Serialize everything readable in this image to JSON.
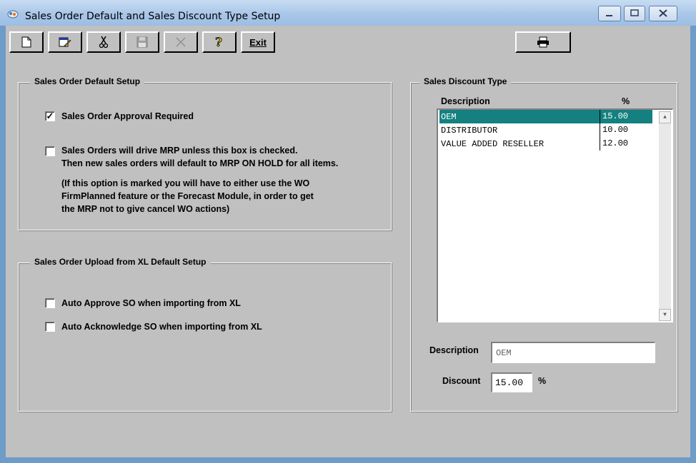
{
  "window": {
    "title": "Sales Order Default and Sales Discount Type Setup"
  },
  "toolbar": {
    "buttons": [
      {
        "name": "new",
        "icon": "new-document-icon"
      },
      {
        "name": "edit",
        "icon": "edit-icon"
      },
      {
        "name": "delete",
        "icon": "scissors-icon"
      },
      {
        "name": "save",
        "icon": "save-icon",
        "disabled": true
      },
      {
        "name": "cancel",
        "icon": "cancel-x-icon",
        "disabled": true
      },
      {
        "name": "help",
        "icon": "help-icon"
      }
    ],
    "exit_label": "Exit",
    "print_icon": "printer-icon"
  },
  "so_default": {
    "title": "Sales Order Default Setup",
    "approval_label": "Sales Order Approval Required",
    "approval_checked": true,
    "mrp_line1": "Sales Orders will drive MRP unless this box is checked.",
    "mrp_line2": "Then new sales orders will default to MRP ON HOLD for all items.",
    "note_line1": "(If this option is marked you will have to either use the WO",
    "note_line2": "FirmPlanned feature or the Forecast Module, in order to get",
    "note_line3": "the MRP not to give cancel WO actions)",
    "mrp_checked": false
  },
  "xl_default": {
    "title": "Sales Order Upload from XL Default Setup",
    "auto_approve_label": "Auto Approve SO when importing from XL",
    "auto_ack_label": "Auto Acknowledge SO when importing from XL",
    "auto_approve_checked": false,
    "auto_ack_checked": false
  },
  "discount": {
    "title": "Sales Discount Type",
    "col_desc": "Description",
    "col_pct": "%",
    "rows": [
      {
        "desc": "OEM",
        "pct": "15.00",
        "selected": true
      },
      {
        "desc": "DISTRIBUTOR",
        "pct": "10.00"
      },
      {
        "desc": "VALUE ADDED RESELLER",
        "pct": "12.00"
      }
    ],
    "desc_label": "Description",
    "desc_value": "OEM",
    "discount_label": "Discount",
    "discount_value": "15.00",
    "pct_suffix": "%"
  },
  "colors": {
    "selection": "#148080",
    "face": "#c0c0c0",
    "frame": "#6f9bc9"
  }
}
